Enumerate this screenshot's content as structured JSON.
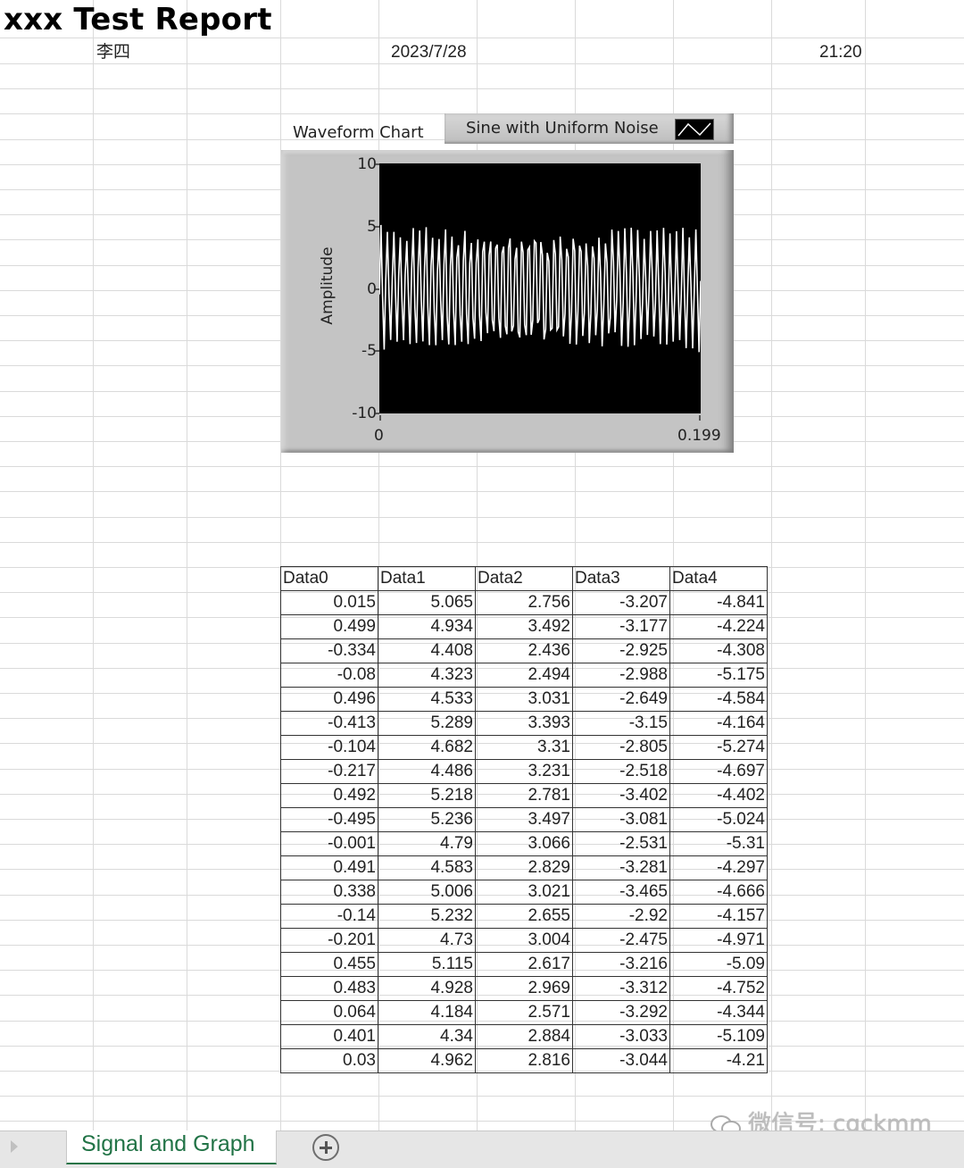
{
  "report": {
    "title": "xxx Test Report",
    "author": "李四",
    "date": "2023/7/28",
    "time": "21:20"
  },
  "chart": {
    "label": "Waveform Chart",
    "legend_label": "Sine with Uniform Noise",
    "legend_icon": "line-plot-icon",
    "ylabel": "Amplitude",
    "yticks": [
      "10",
      "5",
      "0",
      "-5",
      "-10"
    ],
    "xticks": [
      "0",
      "0.199"
    ],
    "colors": {
      "plot_bg": "#000000",
      "trace": "#ffffff",
      "frame": "#c4c4c4"
    }
  },
  "chart_data": {
    "type": "line",
    "title": "Waveform Chart",
    "series": [
      {
        "name": "Sine with Uniform Noise",
        "description": "sine wave, amplitude ~5 with uniform noise ~±0.5, about 50 cycles over the window"
      }
    ],
    "xlabel": "",
    "ylabel": "Amplitude",
    "xlim": [
      0,
      0.199
    ],
    "ylim": [
      -10,
      10
    ],
    "yticks": [
      10,
      5,
      0,
      -5,
      -10
    ],
    "xticks": [
      0,
      0.199
    ],
    "grid": false,
    "legend": "top-right"
  },
  "table": {
    "headers": [
      "Data0",
      "Data1",
      "Data2",
      "Data3",
      "Data4"
    ],
    "rows": [
      [
        "0.015",
        "5.065",
        "2.756",
        "-3.207",
        "-4.841"
      ],
      [
        "0.499",
        "4.934",
        "3.492",
        "-3.177",
        "-4.224"
      ],
      [
        "-0.334",
        "4.408",
        "2.436",
        "-2.925",
        "-4.308"
      ],
      [
        "-0.08",
        "4.323",
        "2.494",
        "-2.988",
        "-5.175"
      ],
      [
        "0.496",
        "4.533",
        "3.031",
        "-2.649",
        "-4.584"
      ],
      [
        "-0.413",
        "5.289",
        "3.393",
        "-3.15",
        "-4.164"
      ],
      [
        "-0.104",
        "4.682",
        "3.31",
        "-2.805",
        "-5.274"
      ],
      [
        "-0.217",
        "4.486",
        "3.231",
        "-2.518",
        "-4.697"
      ],
      [
        "0.492",
        "5.218",
        "2.781",
        "-3.402",
        "-4.402"
      ],
      [
        "-0.495",
        "5.236",
        "3.497",
        "-3.081",
        "-5.024"
      ],
      [
        "-0.001",
        "4.79",
        "3.066",
        "-2.531",
        "-5.31"
      ],
      [
        "0.491",
        "4.583",
        "2.829",
        "-3.281",
        "-4.297"
      ],
      [
        "0.338",
        "5.006",
        "3.021",
        "-3.465",
        "-4.666"
      ],
      [
        "-0.14",
        "5.232",
        "2.655",
        "-2.92",
        "-4.157"
      ],
      [
        "-0.201",
        "4.73",
        "3.004",
        "-2.475",
        "-4.971"
      ],
      [
        "0.455",
        "5.115",
        "2.617",
        "-3.216",
        "-5.09"
      ],
      [
        "0.483",
        "4.928",
        "2.969",
        "-3.312",
        "-4.752"
      ],
      [
        "0.064",
        "4.184",
        "2.571",
        "-3.292",
        "-4.344"
      ],
      [
        "0.401",
        "4.34",
        "2.884",
        "-3.033",
        "-5.109"
      ],
      [
        "0.03",
        "4.962",
        "2.816",
        "-3.044",
        "-4.21"
      ]
    ]
  },
  "sheet_tabs": {
    "active": "Signal and Graph",
    "add_sheet_icon": "plus-circle-icon",
    "scroll_icon": "triangle-right-icon"
  },
  "watermark": {
    "text": "微信号: cgckmm",
    "icon": "wechat-icon"
  }
}
